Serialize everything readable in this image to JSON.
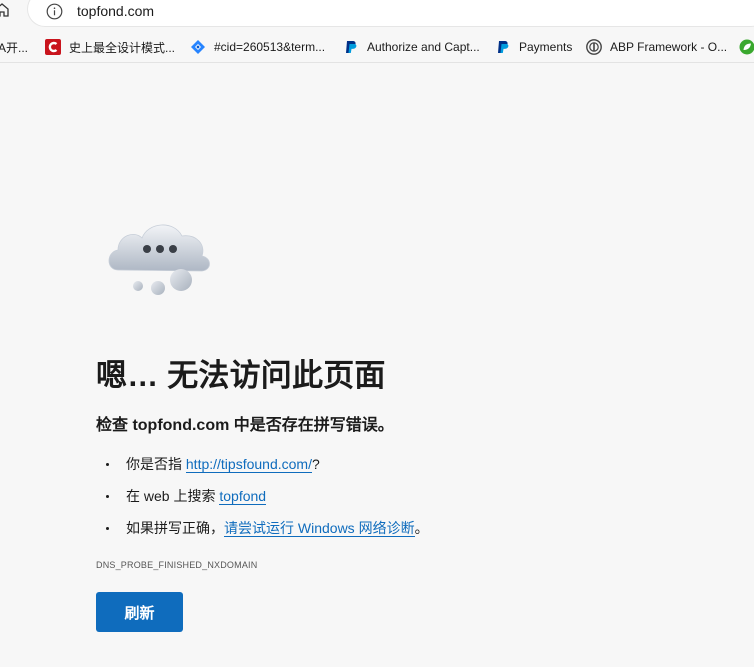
{
  "address_bar": {
    "url": "topfond.com"
  },
  "bookmarks": [
    {
      "label": "A开...",
      "icon": "bookmark-folder-icon"
    },
    {
      "label": "史上最全设计模式...",
      "icon": "csdn-icon",
      "color": "#c9141d"
    },
    {
      "label": "#cid=260513&term...",
      "icon": "jira-icon",
      "color": "#2684ff"
    },
    {
      "label": "Authorize and Capt...",
      "icon": "paypal-icon",
      "color": "#003087"
    },
    {
      "label": "Payments",
      "icon": "paypal-icon",
      "color": "#003087"
    },
    {
      "label": "ABP Framework - O...",
      "icon": "abp-icon",
      "color": "#444444"
    },
    {
      "label": "",
      "icon": "green-leaf-icon",
      "color": "#3aa82e"
    }
  ],
  "error_page": {
    "headline": "嗯… 无法访问此页面",
    "subline": "检查 topfond.com 中是否存在拼写错误。",
    "suggestions": [
      {
        "before": "你是否指 ",
        "link": "http://tipsfound.com/",
        "after": "?"
      },
      {
        "before": "在 web 上搜索 ",
        "link": "topfond",
        "after": ""
      },
      {
        "before": "如果拼写正确，",
        "link": "请尝试运行 Windows 网络诊断",
        "after": "。"
      }
    ],
    "error_code": "DNS_PROBE_FINISHED_NXDOMAIN",
    "refresh_label": "刷新"
  },
  "colors": {
    "accent": "#0f6cbd",
    "background": "#f7f7f7"
  }
}
